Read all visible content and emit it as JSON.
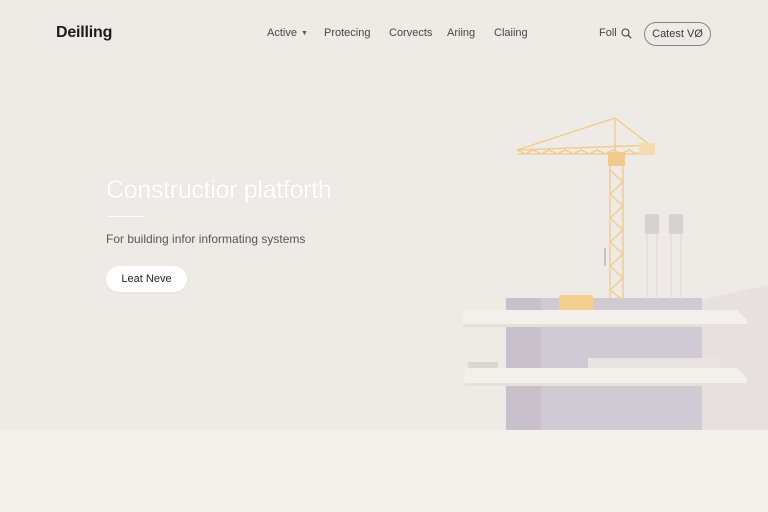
{
  "header": {
    "logo": "Deilling",
    "nav": [
      {
        "label": "Active",
        "has_dropdown": true
      },
      {
        "label": "Protecing"
      },
      {
        "label": "Corvects"
      },
      {
        "label": "Ariing"
      },
      {
        "label": "Claiing"
      }
    ],
    "link": "Foll",
    "cta": "Catest VØ"
  },
  "hero": {
    "title": "Constructior platforth",
    "subtitle": "For building infor informating systems",
    "button": "Leat Neve"
  },
  "colors": {
    "background": "#efebe6",
    "crane": "#f2c98a",
    "building": "#d0cad4",
    "accent_block": "#f5cf8e"
  },
  "icons": {
    "search": "search-icon",
    "dropdown": "chevron-down-icon"
  }
}
